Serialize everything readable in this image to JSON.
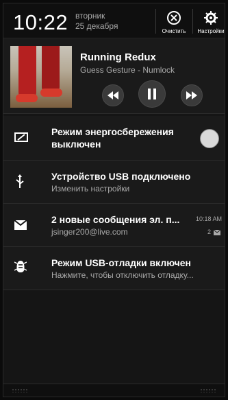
{
  "status": {
    "time": "10:22",
    "day": "вторник",
    "date": "25 декабря",
    "clear_label": "Очистить",
    "settings_label": "Настройки"
  },
  "media": {
    "track": "Running Redux",
    "artist": "Guess Gesture - Numlock",
    "icons": [
      "rewind-icon",
      "pause-icon",
      "fast-forward-icon"
    ]
  },
  "notifications": [
    {
      "icon": "power-saver-icon",
      "title": "Режим энергосбережения выключен",
      "toggle": "off"
    },
    {
      "icon": "usb-icon",
      "title": "Устройство USB подключено",
      "subtitle": "Изменить настройки"
    },
    {
      "icon": "mail-icon",
      "title": "2 новые сообщения эл. п...",
      "subtitle": "jsinger200@live.com",
      "time": "10:18 AM",
      "count": "2"
    },
    {
      "icon": "usb-debug-icon",
      "title": "Режим USB-отладки включен",
      "subtitle": "Нажмите, чтобы отключить отладку..."
    }
  ],
  "colors": {
    "background": "#151515",
    "text": "#ffffff",
    "muted": "#a9a9a9"
  }
}
